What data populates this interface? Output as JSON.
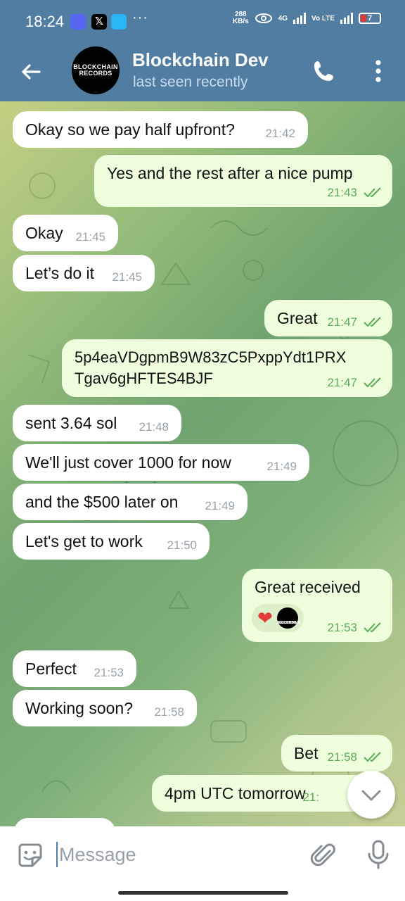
{
  "status_bar": {
    "time": "18:24",
    "net_speed": "288",
    "net_unit": "KB/s",
    "network_type": "4G",
    "volte": "Vo LTE",
    "battery": "7",
    "battery_color": "#e53935",
    "icons": [
      "discord-icon",
      "x-icon",
      "s-app-icon",
      "more-dots-icon",
      "hotspot-icon",
      "signal-icon",
      "battery-icon"
    ]
  },
  "header": {
    "title": "Blockchain Dev",
    "subtitle": "last seen recently",
    "avatar_text_1": "BLOCKCHAIN",
    "avatar_text_2": "RECORDS",
    "bg_color": "#517da2"
  },
  "messages": [
    {
      "dir": "in",
      "text": "Okay so we pay half upfront?",
      "time": "21:42"
    },
    {
      "dir": "out",
      "text": "Yes and the rest after a nice pump",
      "time": "21:43",
      "read": true
    },
    {
      "dir": "in",
      "text": "Okay",
      "time": "21:45"
    },
    {
      "dir": "in",
      "text": "Let’s do it",
      "time": "21:45"
    },
    {
      "dir": "out",
      "text": "Great",
      "time": "21:47",
      "read": true
    },
    {
      "dir": "out",
      "text": "5p4eaVDgpmB9W83zC5PxppYdt1PRX",
      "text2": "Tgav6gHFTES4BJF",
      "time": "21:47",
      "read": true
    },
    {
      "dir": "in",
      "text": "sent 3.64 sol",
      "time": "21:48"
    },
    {
      "dir": "in",
      "text": "We'll just cover 1000 for now",
      "time": "21:49"
    },
    {
      "dir": "in",
      "text": "and the $500 later on",
      "time": "21:49"
    },
    {
      "dir": "in",
      "text": "Let's get to work",
      "time": "21:50"
    },
    {
      "dir": "out",
      "text": "Great received",
      "time": "21:53",
      "read": true,
      "reaction": "❤️"
    },
    {
      "dir": "in",
      "text": "Perfect",
      "time": "21:53"
    },
    {
      "dir": "in",
      "text": "Working soon?",
      "time": "21:58"
    },
    {
      "dir": "out",
      "text": "Bet",
      "time": "21:58",
      "read": true
    },
    {
      "dir": "out",
      "text": "4pm UTC tomorrow",
      "time": "21:",
      "read": true
    }
  ],
  "reaction": {
    "emoji": "❤",
    "avatar_text_1": "BLOCKCHAIN",
    "avatar_text_2": "RECORDS"
  },
  "input": {
    "placeholder": "Message"
  },
  "colors": {
    "incoming": "#ffffff",
    "outgoing": "#effedd",
    "check": "#5bab56",
    "accent": "#517da2"
  }
}
